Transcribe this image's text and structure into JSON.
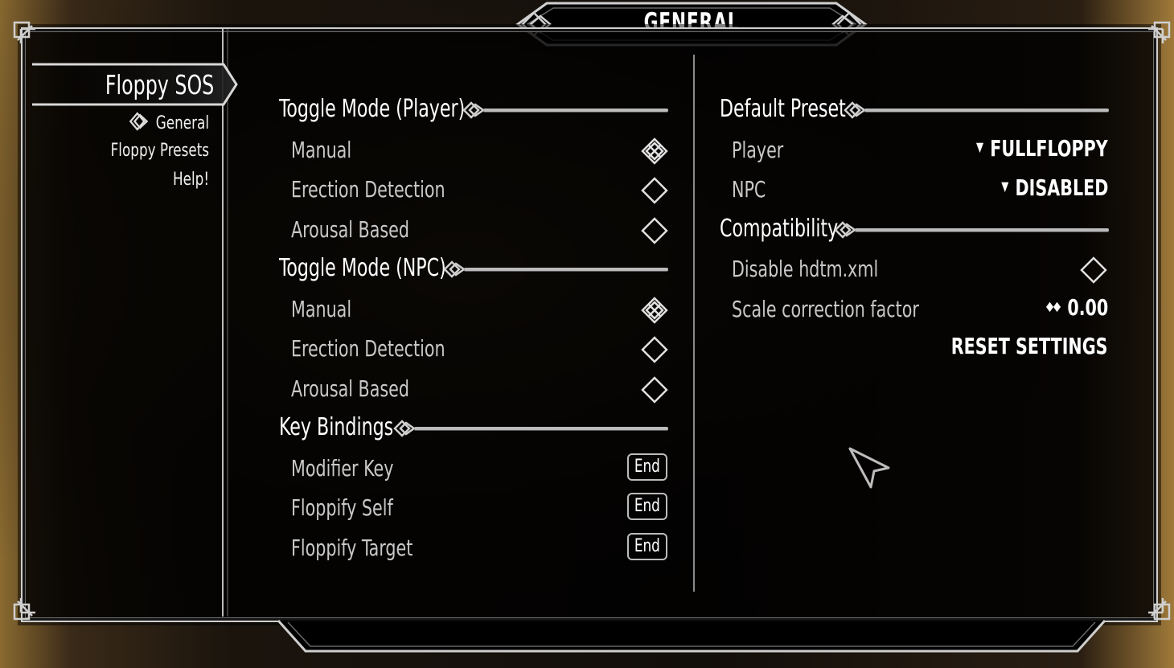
{
  "window": {
    "title": "GENERAL"
  },
  "sidebar": {
    "mod_name": "Floppy SOS",
    "pages": [
      {
        "label": "General",
        "selected": true,
        "icon": "celtic-knot-icon"
      },
      {
        "label": "Floppy Presets",
        "selected": false
      },
      {
        "label": "Help!",
        "selected": false
      }
    ]
  },
  "left_column": {
    "toggle_player": {
      "header": "Toggle Mode (Player)",
      "options": [
        {
          "label": "Manual",
          "checked": true
        },
        {
          "label": "Erection Detection",
          "checked": false
        },
        {
          "label": "Arousal Based",
          "checked": false
        }
      ]
    },
    "toggle_npc": {
      "header": "Toggle Mode (NPC)",
      "options": [
        {
          "label": "Manual",
          "checked": true
        },
        {
          "label": "Erection Detection",
          "checked": false
        },
        {
          "label": "Arousal Based",
          "checked": false
        }
      ]
    },
    "key_bindings": {
      "header": "Key Bindings",
      "keys": [
        {
          "label": "Modifier Key",
          "key": "End"
        },
        {
          "label": "Floppify Self",
          "key": "End"
        },
        {
          "label": "Floppify Target",
          "key": "End"
        }
      ]
    }
  },
  "right_column": {
    "default_preset": {
      "header": "Default Preset",
      "player": {
        "label": "Player",
        "value": "FULLFLOPPY"
      },
      "npc": {
        "label": "NPC",
        "value": "DISABLED"
      }
    },
    "compatibility": {
      "header": "Compatibility",
      "disable_hdtm": {
        "label": "Disable hdtm.xml",
        "checked": false
      },
      "scale_correction": {
        "label": "Scale correction factor",
        "value": "0.00"
      },
      "reset_label": "RESET SETTINGS"
    }
  },
  "colors": {
    "text": "#ffffff",
    "dim_text": "#c8c8c8",
    "line": "#bbbbbb",
    "panel": "#000000"
  }
}
